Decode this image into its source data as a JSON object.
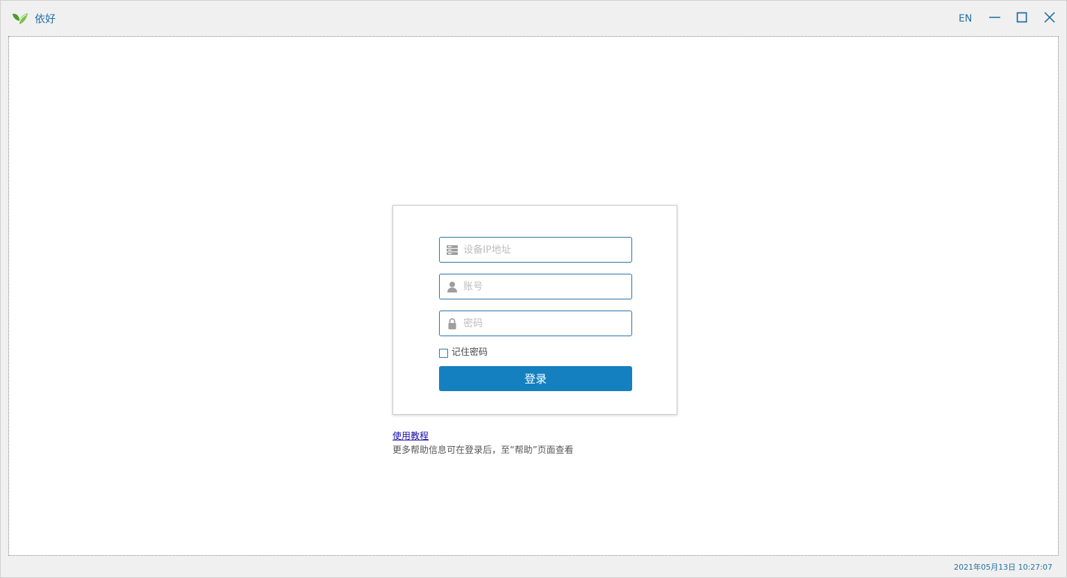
{
  "window": {
    "title": "依好",
    "lang_button": "EN",
    "minimize_icon": "minimize-icon",
    "maximize_icon": "maximize-icon",
    "close_icon": "close-icon",
    "logo_icon": "leaf-logo-icon"
  },
  "login": {
    "ip_field": {
      "placeholder": "设备IP地址",
      "value": "",
      "icon": "server-icon"
    },
    "account_field": {
      "placeholder": "账号",
      "value": "",
      "icon": "user-icon"
    },
    "password_field": {
      "placeholder": "密码",
      "value": "",
      "icon": "lock-icon"
    },
    "remember_label": "记住密码",
    "remember_checked": false,
    "submit_label": "登录"
  },
  "help": {
    "tutorial_link": "使用教程",
    "more_info": "更多帮助信息可在登录后，至“帮助”页面查看"
  },
  "statusbar": {
    "datetime": "2021年05月13日 10:27:07"
  },
  "colors": {
    "accent": "#1f6fa3",
    "button": "#1580c0",
    "link": "#1a0dab",
    "logo_green": "#5fa83a"
  }
}
